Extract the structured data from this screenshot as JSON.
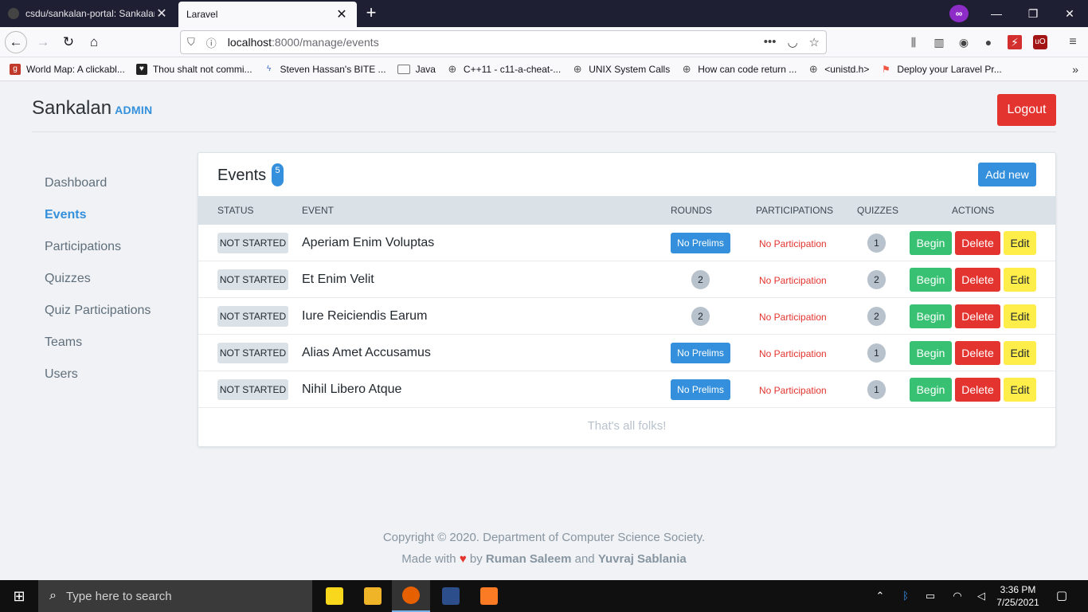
{
  "browser": {
    "tabs": [
      {
        "title": "csdu/sankalan-portal: Sankalan"
      },
      {
        "title": "Laravel"
      }
    ],
    "url_host": "localhost",
    "url_rest": ":8000/manage/events",
    "bookmarks": [
      {
        "label": "World Map: A clickabl...",
        "icon": "g-icon",
        "color": "#c0392b"
      },
      {
        "label": "Thou shalt not commi...",
        "icon": "heart-icon",
        "color": "#222222"
      },
      {
        "label": "Steven Hassan's BITE ...",
        "icon": "squiggle-icon",
        "color": "#3a6bc4"
      },
      {
        "label": "Java",
        "icon": "folder-icon",
        "color": "#777777"
      },
      {
        "label": "C++11 - c11-a-cheat-...",
        "icon": "globe-icon",
        "color": "#555555"
      },
      {
        "label": "UNIX System Calls",
        "icon": "globe-icon",
        "color": "#555555"
      },
      {
        "label": "How can code return ...",
        "icon": "globe-icon",
        "color": "#555555"
      },
      {
        "label": "<unistd.h>",
        "icon": "globe-icon",
        "color": "#555555"
      },
      {
        "label": "Deploy your Laravel Pr...",
        "icon": "laravel-icon",
        "color": "#f05340"
      }
    ]
  },
  "app": {
    "brand": "Sankalan",
    "brand_sub": "ADMIN",
    "logout_label": "Logout"
  },
  "sidebar": {
    "items": [
      {
        "label": "Dashboard"
      },
      {
        "label": "Events"
      },
      {
        "label": "Participations"
      },
      {
        "label": "Quizzes"
      },
      {
        "label": "Quiz Participations"
      },
      {
        "label": "Teams"
      },
      {
        "label": "Users"
      }
    ],
    "active": "Events"
  },
  "events": {
    "title": "Events",
    "count": "5",
    "add_label": "Add new",
    "columns": {
      "status": "STATUS",
      "event": "EVENT",
      "rounds": "ROUNDS",
      "participations": "PARTICIPATIONS",
      "quizzes": "QUIZZES",
      "actions": "ACTIONS"
    },
    "rows": [
      {
        "status": "NOT STARTED",
        "name": "Aperiam Enim Voluptas",
        "rounds": "No Prelims",
        "participation": "No Participation",
        "quizzes": "1"
      },
      {
        "status": "NOT STARTED",
        "name": "Et Enim Velit",
        "rounds": "2",
        "participation": "No Participation",
        "quizzes": "2"
      },
      {
        "status": "NOT STARTED",
        "name": "Iure Reiciendis Earum",
        "rounds": "2",
        "participation": "No Participation",
        "quizzes": "2"
      },
      {
        "status": "NOT STARTED",
        "name": "Alias Amet Accusamus",
        "rounds": "No Prelims",
        "participation": "No Participation",
        "quizzes": "1"
      },
      {
        "status": "NOT STARTED",
        "name": "Nihil Libero Atque",
        "rounds": "No Prelims",
        "participation": "No Participation",
        "quizzes": "1"
      }
    ],
    "actions": {
      "begin": "Begin",
      "delete": "Delete",
      "edit": "Edit"
    },
    "end_text": "That's all folks!"
  },
  "footer": {
    "copyright": "Copyright © 2020. Department of Computer Science Society.",
    "made_with": "Made with",
    "by": "by",
    "author1": "Ruman Saleem",
    "and": "and",
    "author2": "Yuvraj Sablania"
  },
  "taskbar": {
    "search_placeholder": "Type here to search",
    "time": "3:36 PM",
    "date": "7/25/2021"
  },
  "colors": {
    "primary": "#3490dc",
    "success": "#38c172",
    "danger": "#e3342f",
    "warning": "#ffed4a"
  }
}
